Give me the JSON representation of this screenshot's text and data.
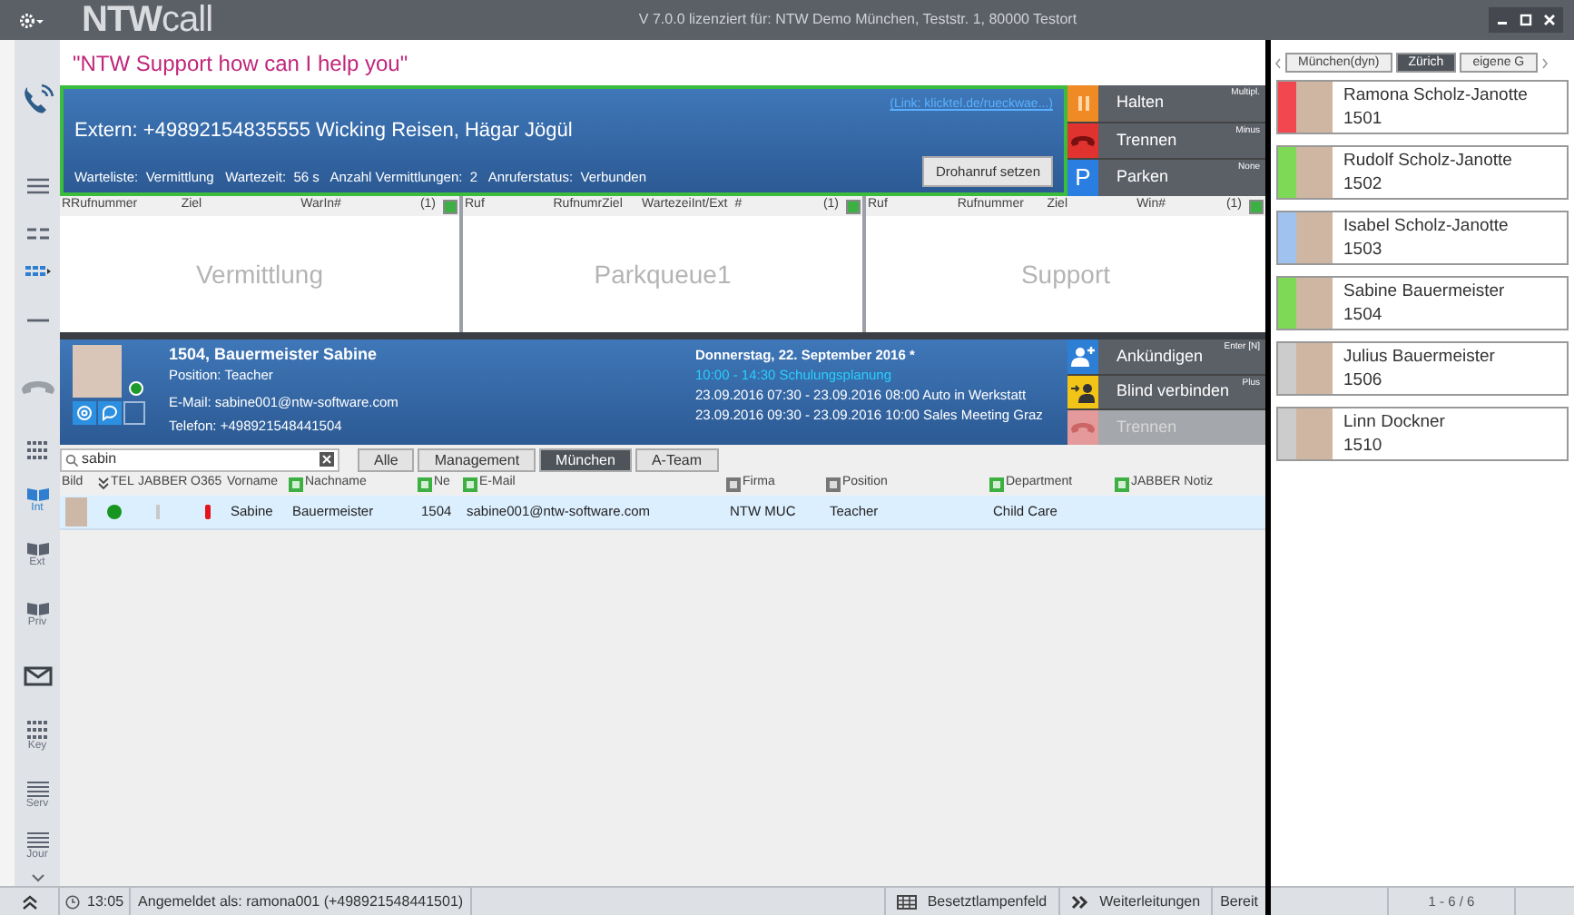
{
  "window": {
    "logo": "**NTW**call",
    "license": "V 7.0.0 lizenziert für:  NTW Demo München, Teststr. 1, 80000 Testort"
  },
  "sidebar": {
    "items": [
      {
        "kind": "call",
        "selected": false
      },
      {
        "kind": "lines3",
        "selected": false
      },
      {
        "kind": "lines2",
        "selected": false
      },
      {
        "kind": "grid",
        "selected": true
      },
      {
        "kind": "dash",
        "selected": false
      },
      {
        "kind": "handset",
        "selected": false
      },
      {
        "kind": "keypad",
        "selected": false
      },
      {
        "kind": "book",
        "label": "Int",
        "selected": true
      },
      {
        "kind": "book",
        "label": "Ext",
        "selected": false
      },
      {
        "kind": "book",
        "label": "Priv",
        "selected": false
      },
      {
        "kind": "mail",
        "selected": false
      },
      {
        "kind": "keypad",
        "label": "Key",
        "selected": false
      },
      {
        "kind": "list",
        "label": "Serv",
        "selected": false
      },
      {
        "kind": "list",
        "label": "Jour",
        "selected": false
      },
      {
        "kind": "chevron",
        "selected": false
      }
    ]
  },
  "greeting": "\"NTW Support how can I help you\"",
  "call": {
    "caller": "Extern:  +49892154835555 Wicking Reisen, Hägar Jögül",
    "details": "Warteliste:  Vermittlung   Wartezeit:  56 s   Anzahl Vermittlungen:  2   Anruferstatus:  Verbunden",
    "link": "(Link: klicktel.de/rueckwae...)",
    "button": "Drohanruf setzen"
  },
  "call_actions": [
    {
      "kind": "hold",
      "label": "Halten",
      "shortcut": "Multipl."
    },
    {
      "kind": "hangup",
      "label": "Trennen",
      "shortcut": "Minus"
    },
    {
      "kind": "park",
      "sign": "P",
      "label": "Parken",
      "shortcut": "None"
    }
  ],
  "queues": [
    {
      "title": "Vermittlung",
      "columns": [
        "RRufnummer",
        "Ziel",
        "WarIn#",
        "(1)"
      ]
    },
    {
      "title": "Parkqueue1",
      "columns": [
        "Ruf",
        "RufnumrZiel",
        "WartezeiInt/Ext",
        "#",
        "(1)"
      ]
    },
    {
      "title": "Support",
      "columns": [
        "Ruf",
        "Rufnummer",
        "Ziel",
        "Win#",
        "(1)"
      ]
    }
  ],
  "contact": {
    "title": "1504, Bauermeister Sabine",
    "position": "Position: Teacher",
    "email": "E-Mail: sabine001@ntw-software.com",
    "phone": "Telefon: +498921548441504",
    "online": true,
    "calendar": {
      "date": "Donnerstag, 22. September 2016 *",
      "entries": [
        {
          "text": "10:00 - 14:30 Schulungsplanung",
          "current": true
        },
        {
          "text": "23.09.2016 07:30 - 23.09.2016 08:00 Auto in Werkstatt",
          "current": false
        },
        {
          "text": "23.09.2016 09:30 - 23.09.2016 10:00 Sales Meeting Graz",
          "current": false
        }
      ]
    }
  },
  "contact_actions": [
    {
      "kind": "announce",
      "label": "Ankündigen",
      "shortcut": "Enter [N]",
      "disabled": false
    },
    {
      "kind": "transfer",
      "label": "Blind verbinden",
      "shortcut": "Plus",
      "disabled": false
    },
    {
      "kind": "hangup",
      "label": "Trennen",
      "disabled": true
    }
  ],
  "search": {
    "value": "sabin"
  },
  "filters": [
    {
      "label": "Alle",
      "selected": false
    },
    {
      "label": "Management",
      "selected": false
    },
    {
      "label": "München",
      "selected": true
    },
    {
      "label": "A-Team",
      "selected": false
    }
  ],
  "table": {
    "columns": [
      {
        "label": "Bild",
        "kind": "plain"
      },
      {
        "label": "TEL",
        "kind": "sort"
      },
      {
        "label": "JABBER",
        "kind": "plain"
      },
      {
        "label": "O365",
        "kind": "plain"
      },
      {
        "label": "Vorname",
        "kind": "plain"
      },
      {
        "label": "Nachname",
        "kind": "filter_on"
      },
      {
        "label": "Ne",
        "kind": "filter_on"
      },
      {
        "label": "E-Mail",
        "kind": "filter_on"
      },
      {
        "label": "Firma",
        "kind": "filter_off"
      },
      {
        "label": "Position",
        "kind": "filter_off"
      },
      {
        "label": "Department",
        "kind": "filter_on"
      },
      {
        "label": "JABBER Notiz",
        "kind": "filter_on"
      }
    ],
    "rows": [
      {
        "selected": true,
        "tel_online": true,
        "jabber_online": false,
        "o365_busy": true,
        "first_name": "Sabine",
        "last_name": "Bauermeister",
        "extension": "1504",
        "email": "sabine001@ntw-software.com",
        "company": "NTW MUC",
        "position": "Teacher",
        "department": "Child Care"
      }
    ]
  },
  "status_bar": {
    "time": "13:05",
    "login": "Angemeldet als:  ramona001 (+498921548441501)",
    "blf": "Besetztlampenfeld",
    "forwarding": "Weiterleitungen",
    "state": "Bereit"
  },
  "panel": {
    "tabs": [
      {
        "label": "München(dyn)",
        "selected": false
      },
      {
        "label": "Zürich",
        "selected": true
      },
      {
        "label": "eigene G",
        "selected": false
      }
    ],
    "contacts": [
      {
        "name": "Ramona Scholz-Janotte",
        "extension": "1501",
        "color": "#f2474f"
      },
      {
        "name": "Rudolf Scholz-Janotte",
        "extension": "1502",
        "color": "#7ed957"
      },
      {
        "name": "Isabel Scholz-Janotte",
        "extension": "1503",
        "color": "#9fc2ee"
      },
      {
        "name": "Sabine Bauermeister",
        "extension": "1504",
        "color": "#7ed957"
      },
      {
        "name": "Julius Bauermeister",
        "extension": "1506",
        "color": "#cccccc"
      },
      {
        "name": "Linn Dockner",
        "extension": "1510",
        "color": "#cccccc"
      }
    ],
    "pager": "1 - 6 / 6"
  }
}
